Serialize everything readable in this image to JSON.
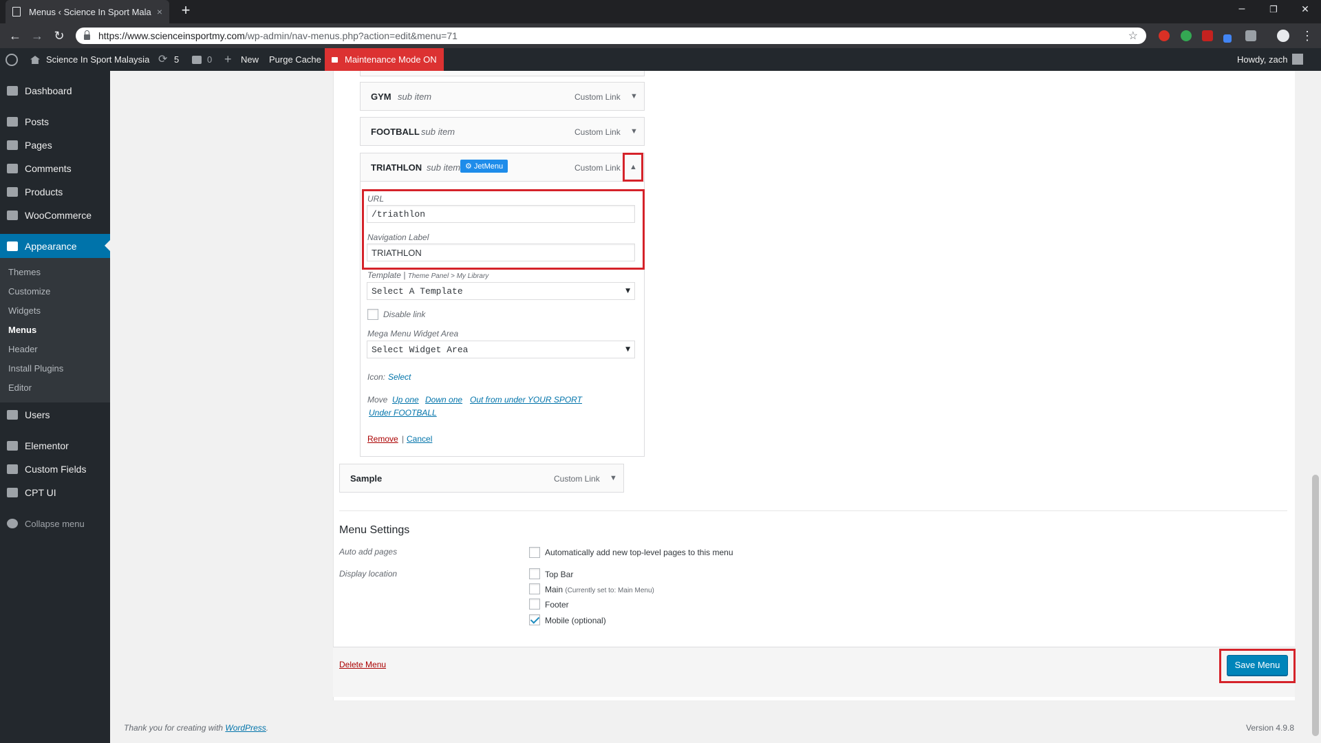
{
  "browser": {
    "tab_title": "Menus ‹ Science In Sport Malays",
    "tab_close": "×",
    "new_tab": "+",
    "url_host": "https://www.scienceinsportmy.com",
    "url_path": "/wp-admin/nav-menus.php?action=edit&menu=71",
    "controls": {
      "minimize": "–",
      "restore": "❐",
      "close": "✕"
    },
    "nav": {
      "back": "←",
      "forward": "→",
      "reload": "↻",
      "star": "☆",
      "menu": "⋮"
    }
  },
  "adminbar": {
    "site_name": "Science In Sport Malaysia",
    "updates_count": "5",
    "comments_count": "0",
    "new_label": "New",
    "purge_label": "Purge Cache",
    "maintenance_label": "Maintenance Mode ON",
    "howdy": "Howdy, zach"
  },
  "sidebar": {
    "items": [
      {
        "label": "Dashboard",
        "icon": "dashboard-icon"
      },
      {
        "label": "Posts",
        "icon": "pin-icon"
      },
      {
        "label": "Pages",
        "icon": "pages-icon"
      },
      {
        "label": "Comments",
        "icon": "comment-icon"
      },
      {
        "label": "Products",
        "icon": "box-icon"
      },
      {
        "label": "WooCommerce",
        "icon": "woocommerce-icon"
      },
      {
        "label": "Appearance",
        "icon": "brush-icon"
      },
      {
        "label": "Users",
        "icon": "user-icon"
      },
      {
        "label": "Elementor",
        "icon": "elementor-icon"
      },
      {
        "label": "Custom Fields",
        "icon": "table-icon"
      },
      {
        "label": "CPT UI",
        "icon": "grid-icon"
      },
      {
        "label": "Collapse menu",
        "icon": "collapse-icon"
      }
    ],
    "appearance_submenu": [
      "Themes",
      "Customize",
      "Widgets",
      "Menus",
      "Header",
      "Install Plugins",
      "Editor"
    ]
  },
  "menu_items": {
    "gym": {
      "title": "GYM",
      "sub": "sub item",
      "type": "Custom Link"
    },
    "football": {
      "title": "FOOTBALL",
      "sub": "sub item",
      "type": "Custom Link"
    },
    "triathlon": {
      "title": "TRIATHLON",
      "sub": "sub item",
      "badge": "JetMenu",
      "type": "Custom Link"
    },
    "sample": {
      "title": "Sample",
      "type": "Custom Link"
    }
  },
  "item_settings": {
    "url_label": "URL",
    "url_value": "/triathlon",
    "nav_label_label": "Navigation Label",
    "nav_label_value": "TRIATHLON",
    "template_label": "Template",
    "template_hint": "Theme Panel > My Library",
    "template_select": "Select A Template",
    "disable_link": "Disable link",
    "mega_label": "Mega Menu Widget Area",
    "mega_select": "Select Widget Area",
    "icon_label": "Icon:",
    "icon_select": "Select",
    "move_label": "Move",
    "move_up": "Up one",
    "move_down": "Down one",
    "move_out": "Out from under YOUR SPORT",
    "move_under": "Under FOOTBALL",
    "remove": "Remove",
    "cancel": "Cancel"
  },
  "menu_settings": {
    "heading": "Menu Settings",
    "auto_add_label": "Auto add pages",
    "auto_add_option": "Automatically add new top-level pages to this menu",
    "display_label": "Display location",
    "locations": [
      {
        "label": "Top Bar",
        "note": "",
        "checked": false
      },
      {
        "label": "Main",
        "note": "(Currently set to: Main Menu)",
        "checked": false
      },
      {
        "label": "Footer",
        "note": "",
        "checked": false
      },
      {
        "label": "Mobile (optional)",
        "note": "",
        "checked": true
      }
    ]
  },
  "footer": {
    "delete_menu": "Delete Menu",
    "save_menu": "Save Menu",
    "thanks_prefix": "Thank you for creating with",
    "thanks_link": "WordPress",
    "version": "Version 4.9.8"
  }
}
